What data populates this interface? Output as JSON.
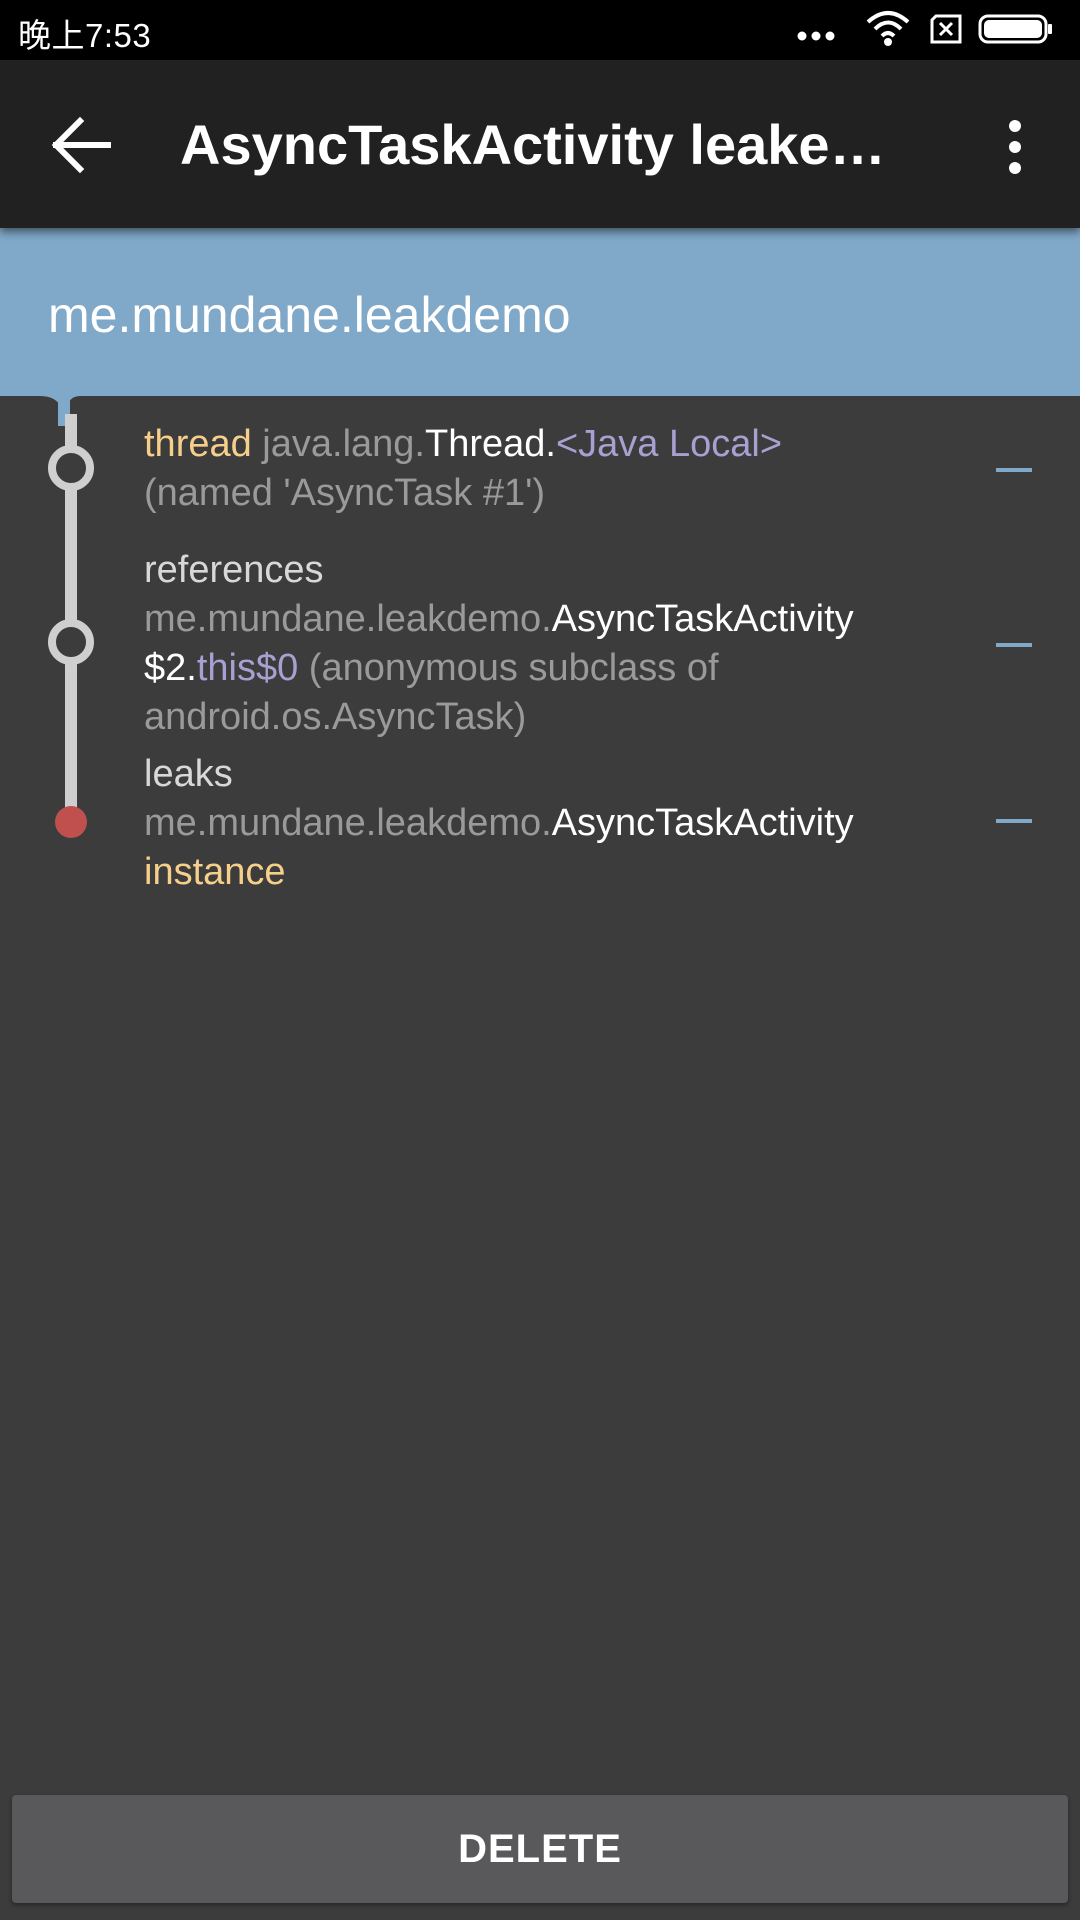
{
  "status_bar": {
    "time": "晚上7:53",
    "icons": [
      "more-dots-icon",
      "wifi-icon",
      "no-sim-icon",
      "battery-icon"
    ]
  },
  "app_bar": {
    "title": "AsyncTaskActivity leaked…",
    "back_icon": "arrow-back-icon",
    "menu_icon": "more-vert-icon"
  },
  "header": {
    "package": "me.mundane.leakdemo"
  },
  "trace": [
    {
      "line1": {
        "kw": "thread",
        "pkg": " java.lang.",
        "cls": "Thread.",
        "field": "<Java Local>"
      },
      "line2": "(named 'AsyncTask #1')"
    },
    {
      "label": "references",
      "line1": {
        "pkg": "me.mundane.leakdemo.",
        "cls": "AsyncTaskActivity"
      },
      "line2": {
        "cls": "$2.",
        "field": "this$0",
        "rest": " (anonymous subclass of"
      },
      "line3": "android.os.AsyncTask)"
    },
    {
      "label": "leaks",
      "line1": {
        "pkg": "me.mundane.leakdemo.",
        "cls": "AsyncTaskActivity"
      },
      "line2": "instance"
    }
  ],
  "colors": {
    "accent": "#80a8c8",
    "leak_dot": "#c0504d",
    "keyword": "#f6cf8b",
    "field": "#a99fd0"
  },
  "delete_button": {
    "label": "DELETE"
  }
}
